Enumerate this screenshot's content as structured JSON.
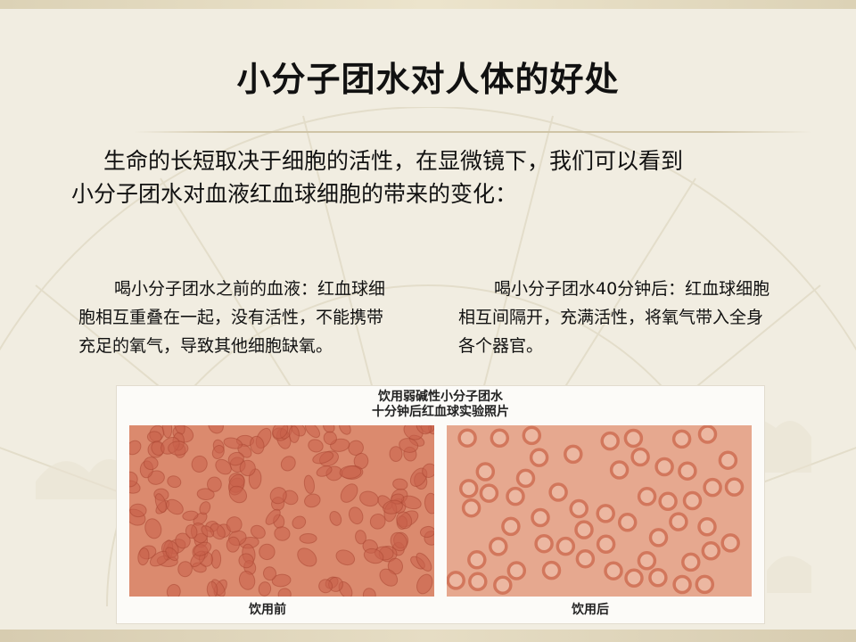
{
  "slide": {
    "title": "小分子团水对人体的好处",
    "intro_line1": "生命的长短取决于细胞的活性，在显微镜下，我们可以看到",
    "intro_line2": "小分子团水对血液红血球细胞的带来的变化："
  },
  "captions": {
    "before": "喝小分子团水之前的血液：红血球细胞相互重叠在一起，没有活性，不能携带充足的氧气，导致其他细胞缺氧。",
    "after": "喝小分子团水40分钟后：红血球细胞相互间隔开，充满活性，将氧气带入全身各个器官。"
  },
  "photo": {
    "title_line1": "饮用弱碱性小分子团水",
    "title_line2": "十分钟后红血球实验照片",
    "label_before": "饮用前",
    "label_after": "饮用后"
  },
  "colors": {
    "before_bg": "#db8a6e",
    "after_bg": "#e6a88f",
    "cell_before": "#c9614a",
    "cell_after": "#d2775c"
  }
}
